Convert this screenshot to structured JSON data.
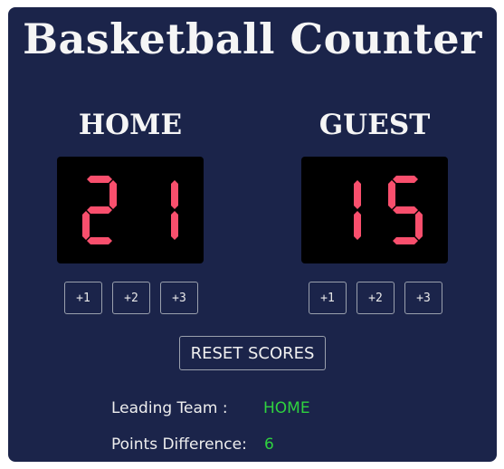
{
  "app": {
    "title": "Basketball Counter"
  },
  "home": {
    "name": "HOME",
    "score": "21",
    "buttons": [
      "+1",
      "+2",
      "+3"
    ]
  },
  "guest": {
    "name": "GUEST",
    "score": "15",
    "buttons": [
      "+1",
      "+2",
      "+3"
    ]
  },
  "controls": {
    "reset_label": "RESET SCORES"
  },
  "stats": {
    "leading_label": "Leading Team :",
    "leading_value": "HOME",
    "difference_label": "Points Difference:",
    "difference_value": "6"
  },
  "colors": {
    "background": "#1b244a",
    "digit": "#f94f6d",
    "highlight": "#2fd23f",
    "text": "#f5f5f5"
  }
}
